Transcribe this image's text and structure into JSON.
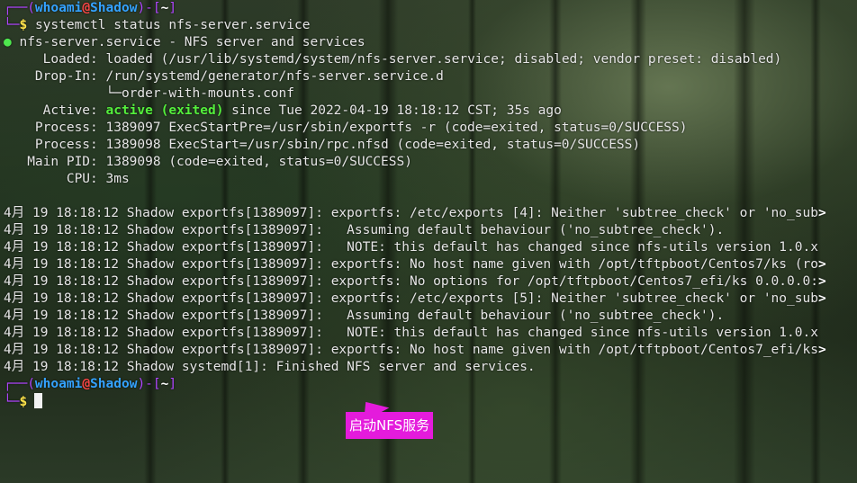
{
  "prompt": {
    "user": "whoami",
    "at": "@",
    "host": "Shadow",
    "dir": "~"
  },
  "command": "systemctl status nfs-server.service",
  "status": {
    "dot": "●",
    "header": "nfs-server.service - NFS server and services",
    "loaded_label": "     Loaded: ",
    "loaded_value": "loaded (/usr/lib/systemd/system/nfs-server.service; disabled; vendor preset: disabled)",
    "dropin_label": "    Drop-In: ",
    "dropin_value": "/run/systemd/generator/nfs-server.service.d",
    "dropin_sub": "             └─order-with-mounts.conf",
    "active_label": "     Active: ",
    "active_state": "active (exited)",
    "active_rest": " since Tue 2022-04-19 18:18:12 CST; 35s ago",
    "process1": "    Process: 1389097 ExecStartPre=/usr/sbin/exportfs -r (code=exited, status=0/SUCCESS)",
    "process2": "    Process: 1389098 ExecStart=/usr/sbin/rpc.nfsd (code=exited, status=0/SUCCESS)",
    "mainpid": "   Main PID: 1389098 (code=exited, status=0/SUCCESS)",
    "cpu": "        CPU: 3ms"
  },
  "logs": [
    {
      "text": "4月 19 18:18:12 Shadow exportfs[1389097]: exportfs: /etc/exports [4]: Neither 'subtree_check' or 'no_sub",
      "trunc": ">"
    },
    {
      "text": "4月 19 18:18:12 Shadow exportfs[1389097]:   Assuming default behaviour ('no_subtree_check').",
      "trunc": ""
    },
    {
      "text": "4月 19 18:18:12 Shadow exportfs[1389097]:   NOTE: this default has changed since nfs-utils version 1.0.x",
      "trunc": ""
    },
    {
      "text": "4月 19 18:18:12 Shadow exportfs[1389097]: exportfs: No host name given with /opt/tftpboot/Centos7/ks (ro",
      "trunc": ">"
    },
    {
      "text": "4月 19 18:18:12 Shadow exportfs[1389097]: exportfs: No options for /opt/tftpboot/Centos7_efi/ks 0.0.0.0:",
      "trunc": ">"
    },
    {
      "text": "4月 19 18:18:12 Shadow exportfs[1389097]: exportfs: /etc/exports [5]: Neither 'subtree_check' or 'no_sub",
      "trunc": ">"
    },
    {
      "text": "4月 19 18:18:12 Shadow exportfs[1389097]:   Assuming default behaviour ('no_subtree_check').",
      "trunc": ""
    },
    {
      "text": "4月 19 18:18:12 Shadow exportfs[1389097]:   NOTE: this default has changed since nfs-utils version 1.0.x",
      "trunc": ""
    },
    {
      "text": "4月 19 18:18:12 Shadow exportfs[1389097]: exportfs: No host name given with /opt/tftpboot/Centos7_efi/ks",
      "trunc": ">"
    },
    {
      "text": "4月 19 18:18:12 Shadow systemd[1]: Finished NFS server and services.",
      "trunc": ""
    }
  ],
  "annotation": "启动NFS服务",
  "colors": {
    "prompt_frame": "#b146ff",
    "user_host": "#34a2ff",
    "at_sign": "#ff4646",
    "dollar": "#ffe44a",
    "active": "#54ef3c",
    "annotation_bg": "#e41bdc"
  }
}
